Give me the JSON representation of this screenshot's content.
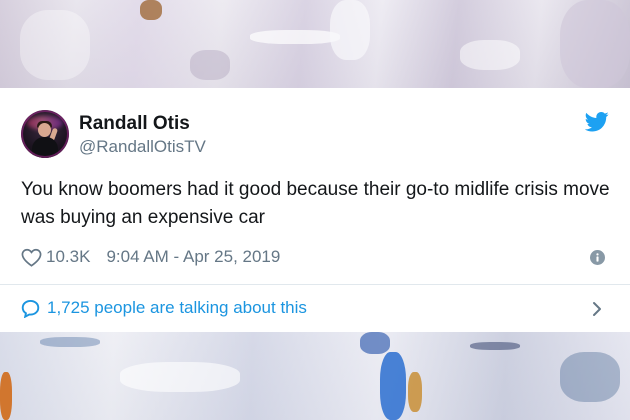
{
  "tweet": {
    "author_name": "Randall Otis",
    "author_handle": "@RandallOtisTV",
    "text": "You know boomers had it good because their go-to midlife crisis move was buying an expensive car",
    "likes": "10.3K",
    "timestamp": "9:04 AM - Apr 25, 2019",
    "conversation": "1,725 people are talking about this"
  },
  "icons": {
    "brand": "twitter-bird-icon",
    "like": "heart-icon",
    "info": "info-icon",
    "reply": "speech-bubble-icon",
    "more": "chevron-right-icon"
  },
  "colors": {
    "brand_blue": "#1da1f2",
    "link_blue": "#1b95e0",
    "text_primary": "#14171a",
    "text_secondary": "#657786",
    "divider": "#e1e8ed"
  }
}
